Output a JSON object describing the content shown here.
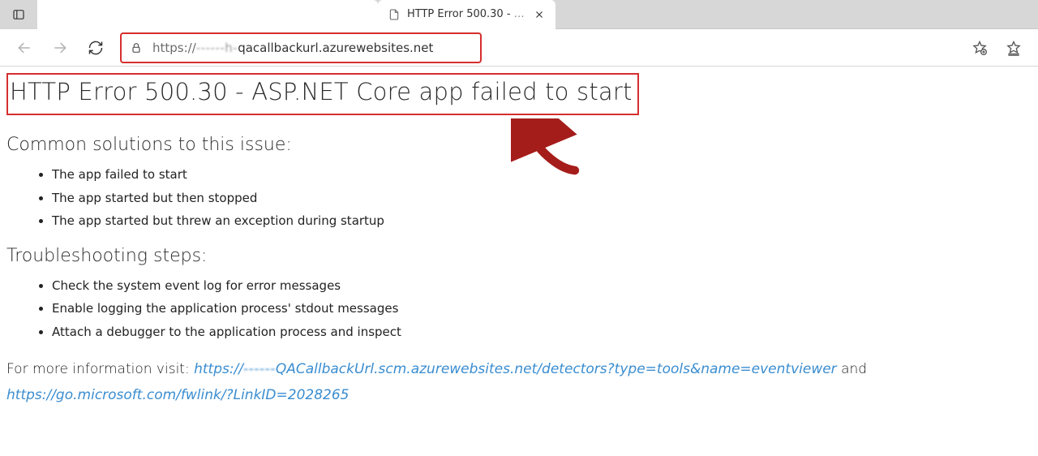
{
  "tabs": {
    "blank_title": "",
    "active_title": "HTTP Error 500.30 -"
  },
  "address_bar": {
    "scheme": "https://",
    "obscured": "------h-",
    "host_suffix": "qacallbackurl.azurewebsites.net"
  },
  "page": {
    "heading": "HTTP Error 500.30 - ASP.NET Core app failed to start",
    "common_solutions_heading": "Common solutions to this issue:",
    "common_solutions": [
      "The app failed to start",
      "The app started but then stopped",
      "The app started but threw an exception during startup"
    ],
    "troubleshooting_heading": "Troubleshooting steps:",
    "troubleshooting": [
      "Check the system event log for error messages",
      "Enable logging the application process' stdout messages",
      "Attach a debugger to the application process and inspect"
    ],
    "more_info_prefix": "For more information visit: ",
    "link1_prefix": "https://",
    "link1_obscured": "------",
    "link1_suffix": "QACallbackUrl.scm.azurewebsites.net/detectors?type=tools&name=eventviewer",
    "and_text": " and ",
    "link2": "https://go.microsoft.com/fwlink/?LinkID=2028265"
  },
  "icons": {
    "tab_manager": "tab-manager-icon",
    "favicon": "page-icon",
    "close": "close-icon",
    "back": "back-icon",
    "forward": "forward-icon",
    "refresh": "refresh-icon",
    "lock": "lock-icon",
    "favorite": "favorite-add-icon",
    "collections": "collections-icon"
  },
  "annotation": {
    "url_highlight": true,
    "heading_highlight": true,
    "arrow": true
  }
}
